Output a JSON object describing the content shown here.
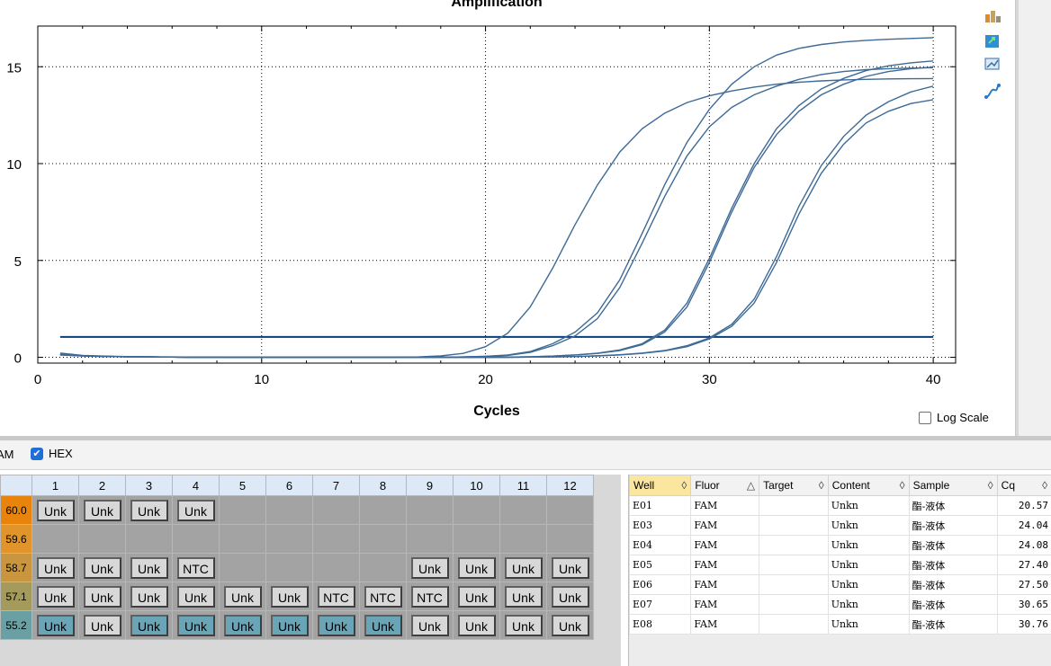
{
  "chart_data": {
    "type": "line",
    "title": "Amplification",
    "xlabel": "Cycles",
    "ylabel": "",
    "xlim": [
      0,
      41
    ],
    "ylim": [
      -0.3,
      17.1
    ],
    "x_ticks": [
      0,
      10,
      20,
      30,
      40
    ],
    "y_ticks": [
      0,
      5,
      10,
      15
    ],
    "grid": "dotted",
    "threshold": 1.05,
    "x": [
      1,
      2,
      3,
      4,
      5,
      6,
      7,
      8,
      9,
      10,
      11,
      12,
      13,
      14,
      15,
      16,
      17,
      18,
      19,
      20,
      21,
      22,
      23,
      24,
      25,
      26,
      27,
      28,
      29,
      30,
      31,
      32,
      33,
      34,
      35,
      36,
      37,
      38,
      39,
      40
    ],
    "series": [
      {
        "values": [
          0.22,
          0.1,
          0.06,
          0.04,
          0.03,
          0.02,
          0.01,
          0.01,
          0.0,
          0.0,
          0.0,
          0.0,
          0.0,
          0.0,
          0.0,
          0.0,
          0.02,
          0.07,
          0.2,
          0.55,
          1.25,
          2.6,
          4.6,
          6.85,
          8.9,
          10.6,
          11.8,
          12.6,
          13.15,
          13.5,
          13.75,
          13.95,
          14.1,
          14.2,
          14.27,
          14.32,
          14.35,
          14.37,
          14.38,
          14.39
        ]
      },
      {
        "values": [
          0.15,
          0.08,
          0.05,
          0.03,
          0.02,
          0.01,
          0.0,
          0.0,
          0.0,
          0.0,
          0.0,
          0.0,
          0.0,
          0.0,
          0.0,
          0.0,
          0.0,
          0.0,
          0.02,
          0.05,
          0.1,
          0.25,
          0.6,
          1.1,
          2.0,
          3.6,
          5.9,
          8.3,
          10.4,
          11.9,
          12.9,
          13.55,
          14.0,
          14.35,
          14.6,
          14.75,
          14.85,
          14.9,
          14.93,
          14.95
        ]
      },
      {
        "values": [
          0.15,
          0.08,
          0.05,
          0.03,
          0.02,
          0.01,
          0.0,
          0.0,
          0.0,
          0.0,
          0.0,
          0.0,
          0.0,
          0.0,
          0.0,
          0.0,
          0.0,
          0.01,
          0.02,
          0.05,
          0.12,
          0.3,
          0.7,
          1.3,
          2.3,
          4.0,
          6.4,
          8.9,
          11.1,
          12.8,
          14.1,
          15.0,
          15.6,
          15.95,
          16.15,
          16.28,
          16.36,
          16.42,
          16.46,
          16.5
        ]
      },
      {
        "values": [
          0.14,
          0.08,
          0.05,
          0.03,
          0.02,
          0.01,
          0.0,
          0.0,
          0.0,
          0.0,
          0.0,
          0.0,
          0.0,
          0.0,
          0.0,
          0.0,
          0.0,
          0.0,
          0.0,
          0.0,
          0.01,
          0.03,
          0.06,
          0.12,
          0.2,
          0.35,
          0.65,
          1.3,
          2.6,
          4.9,
          7.5,
          9.8,
          11.5,
          12.7,
          13.55,
          14.1,
          14.5,
          14.75,
          14.9,
          14.98
        ]
      },
      {
        "values": [
          0.14,
          0.08,
          0.05,
          0.03,
          0.02,
          0.01,
          0.0,
          0.0,
          0.0,
          0.0,
          0.0,
          0.0,
          0.0,
          0.0,
          0.0,
          0.0,
          0.0,
          0.0,
          0.0,
          0.0,
          0.01,
          0.03,
          0.06,
          0.12,
          0.21,
          0.38,
          0.7,
          1.4,
          2.8,
          5.1,
          7.7,
          10.0,
          11.8,
          13.0,
          13.85,
          14.4,
          14.8,
          15.05,
          15.2,
          15.3
        ]
      },
      {
        "values": [
          0.12,
          0.07,
          0.04,
          0.03,
          0.02,
          0.01,
          0.0,
          0.0,
          0.0,
          0.0,
          0.0,
          0.0,
          0.0,
          0.0,
          0.0,
          0.0,
          0.0,
          0.0,
          0.0,
          0.0,
          0.0,
          0.01,
          0.02,
          0.04,
          0.08,
          0.13,
          0.22,
          0.35,
          0.6,
          1.0,
          1.7,
          3.0,
          5.2,
          7.8,
          9.9,
          11.4,
          12.5,
          13.2,
          13.7,
          14.0
        ]
      },
      {
        "values": [
          0.12,
          0.07,
          0.04,
          0.03,
          0.02,
          0.01,
          0.0,
          0.0,
          0.0,
          0.0,
          0.0,
          0.0,
          0.0,
          0.0,
          0.0,
          0.0,
          0.0,
          0.0,
          0.0,
          0.0,
          0.0,
          0.01,
          0.02,
          0.04,
          0.07,
          0.12,
          0.2,
          0.33,
          0.55,
          0.95,
          1.6,
          2.8,
          4.9,
          7.4,
          9.5,
          11.0,
          12.1,
          12.7,
          13.1,
          13.3
        ]
      }
    ]
  },
  "toolbar_icons": [
    "chart-settings-icon",
    "export-icon",
    "zoom-icon",
    "curve-icon"
  ],
  "log_scale_label": "Log Scale",
  "filters": {
    "fam_label": "AM",
    "hex_label": "HEX"
  },
  "plate": {
    "columns": [
      "1",
      "2",
      "3",
      "4",
      "5",
      "6",
      "7",
      "8",
      "9",
      "10",
      "11",
      "12"
    ],
    "rows": [
      {
        "temp": "60.0",
        "temp_color": "#e8830c",
        "cells": [
          {
            "label": "Unk"
          },
          {
            "label": "Unk"
          },
          {
            "label": "Unk"
          },
          {
            "label": "Unk"
          },
          null,
          null,
          null,
          null,
          null,
          null,
          null,
          null
        ]
      },
      {
        "temp": "59.6",
        "temp_color": "#e0942a",
        "cells": [
          null,
          null,
          null,
          null,
          null,
          null,
          null,
          null,
          null,
          null,
          null,
          null
        ]
      },
      {
        "temp": "58.7",
        "temp_color": "#c9963f",
        "cells": [
          {
            "label": "Unk"
          },
          {
            "label": "Unk"
          },
          {
            "label": "Unk"
          },
          {
            "label": "NTC"
          },
          null,
          null,
          null,
          null,
          {
            "label": "Unk"
          },
          {
            "label": "Unk"
          },
          {
            "label": "Unk"
          },
          {
            "label": "Unk"
          }
        ]
      },
      {
        "temp": "57.1",
        "temp_color": "#a39a5c",
        "cells": [
          {
            "label": "Unk"
          },
          {
            "label": "Unk"
          },
          {
            "label": "Unk"
          },
          {
            "label": "Unk"
          },
          {
            "label": "Unk"
          },
          {
            "label": "Unk"
          },
          {
            "label": "NTC"
          },
          {
            "label": "NTC"
          },
          {
            "label": "NTC"
          },
          {
            "label": "Unk"
          },
          {
            "label": "Unk"
          },
          {
            "label": "Unk"
          }
        ]
      },
      {
        "temp": "55.2",
        "temp_color": "#6aa0a3",
        "cells": [
          {
            "label": "Unk",
            "teal": true
          },
          {
            "label": "Unk"
          },
          {
            "label": "Unk",
            "teal": true
          },
          {
            "label": "Unk",
            "teal": true
          },
          {
            "label": "Unk",
            "teal": true
          },
          {
            "label": "Unk",
            "teal": true
          },
          {
            "label": "Unk",
            "teal": true
          },
          {
            "label": "Unk",
            "teal": true
          },
          {
            "label": "Unk"
          },
          {
            "label": "Unk"
          },
          {
            "label": "Unk"
          },
          {
            "label": "Unk"
          }
        ]
      }
    ]
  },
  "well_table": {
    "headers": [
      {
        "label": "Well",
        "sort": "◊",
        "selected": true
      },
      {
        "label": "Fluor",
        "sort": "△"
      },
      {
        "label": "Target",
        "sort": "◊"
      },
      {
        "label": "Content",
        "sort": "◊"
      },
      {
        "label": "Sample",
        "sort": "◊"
      },
      {
        "label": "Cq",
        "sort": "◊"
      }
    ],
    "rows": [
      {
        "well": "E01",
        "fluor": "FAM",
        "target": "",
        "content": "Unkn",
        "sample": "酯-液体",
        "cq": "20.57"
      },
      {
        "well": "E03",
        "fluor": "FAM",
        "target": "",
        "content": "Unkn",
        "sample": "酯-液体",
        "cq": "24.04"
      },
      {
        "well": "E04",
        "fluor": "FAM",
        "target": "",
        "content": "Unkn",
        "sample": "酯-液体",
        "cq": "24.08"
      },
      {
        "well": "E05",
        "fluor": "FAM",
        "target": "",
        "content": "Unkn",
        "sample": "酯-液体",
        "cq": "27.40"
      },
      {
        "well": "E06",
        "fluor": "FAM",
        "target": "",
        "content": "Unkn",
        "sample": "酯-液体",
        "cq": "27.50"
      },
      {
        "well": "E07",
        "fluor": "FAM",
        "target": "",
        "content": "Unkn",
        "sample": "酯-液体",
        "cq": "30.65"
      },
      {
        "well": "E08",
        "fluor": "FAM",
        "target": "",
        "content": "Unkn",
        "sample": "酯-液体",
        "cq": "30.76"
      }
    ]
  }
}
